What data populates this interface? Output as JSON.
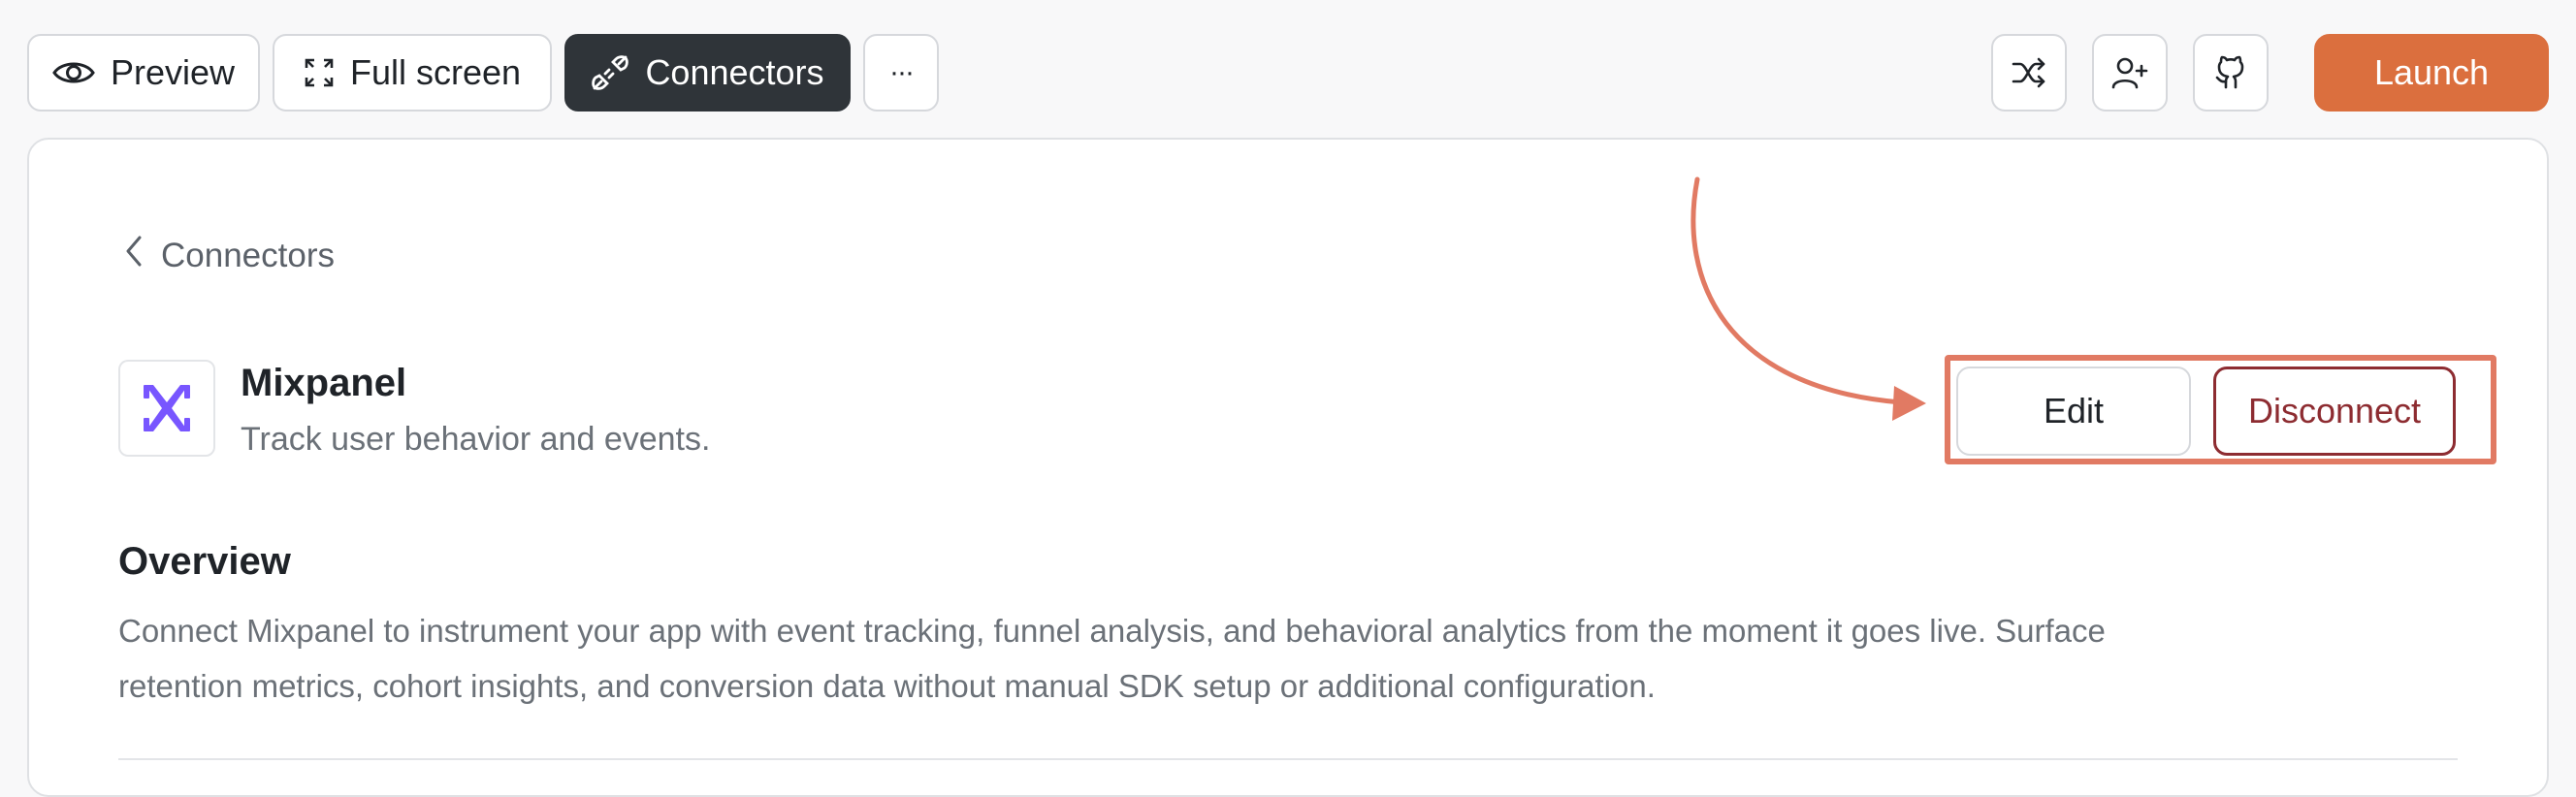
{
  "toolbar": {
    "preview_label": "Preview",
    "fullscreen_label": "Full screen",
    "connectors_label": "Connectors",
    "more_label": "···",
    "launch_label": "Launch"
  },
  "page": {
    "breadcrumb_label": "Connectors",
    "app_name": "Mixpanel",
    "app_description": "Track user behavior and events.",
    "edit_label": "Edit",
    "disconnect_label": "Disconnect",
    "overview_title": "Overview",
    "overview_line1": "Connect Mixpanel to instrument your app with event tracking, funnel analysis, and behavioral analytics from the moment it goes live. Surface",
    "overview_line2": "retention metrics, cohort insights, and conversion data without manual SDK setup or additional configuration."
  },
  "colors": {
    "accent": "#db6f3e",
    "dark_button": "#2f3439",
    "disconnect": "#8d2c31",
    "highlight": "#e17a63",
    "mixpanel_logo": "#7856ff"
  },
  "icons": {
    "preview": "eye-icon",
    "fullscreen": "expand-icon",
    "connectors": "plug-icon",
    "shuffle": "shuffle-icon",
    "add_user": "user-plus-icon",
    "github": "github-icon",
    "back": "chevron-left-icon",
    "logo": "mixpanel-logo-icon"
  }
}
